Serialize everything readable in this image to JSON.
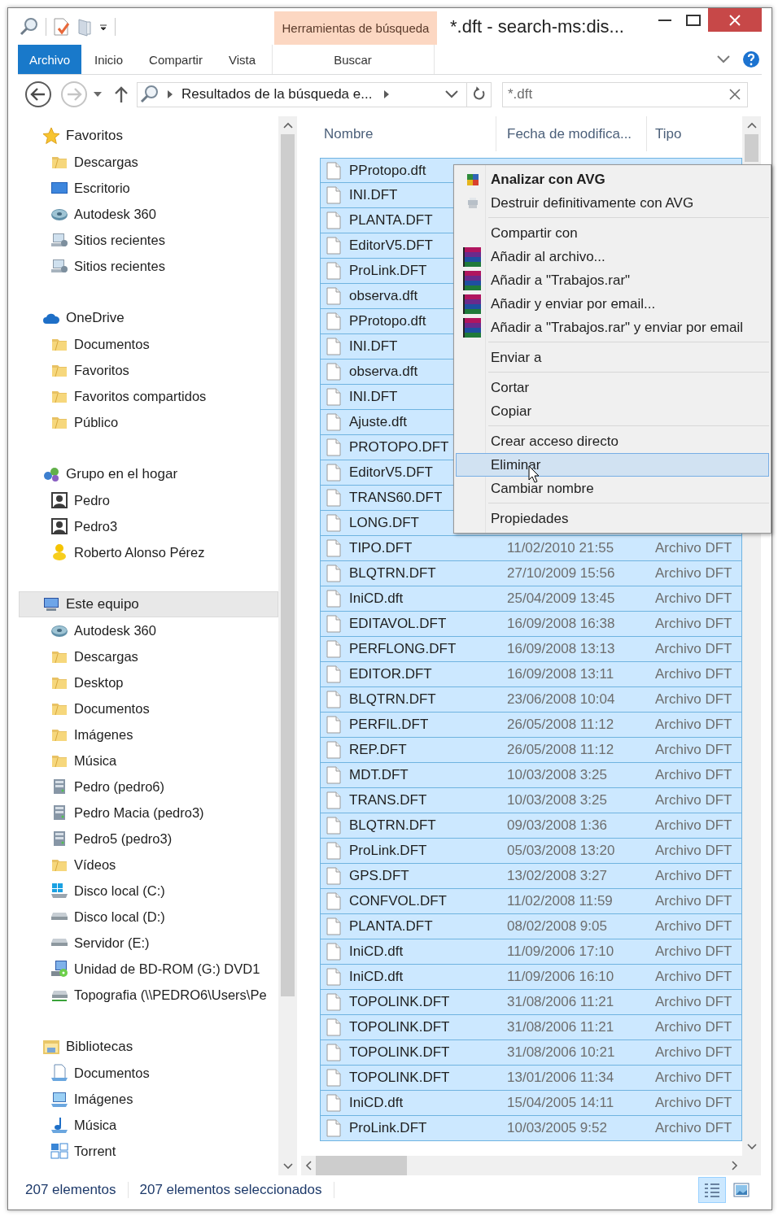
{
  "window": {
    "title": "*.dft - search-ms:dis..."
  },
  "context_tab": {
    "label": "Herramientas de búsqueda"
  },
  "ribbon_tabs": [
    {
      "label": "Archivo",
      "kind": "file",
      "selected": false
    },
    {
      "label": "Inicio",
      "kind": "tab",
      "selected": false
    },
    {
      "label": "Compartir",
      "kind": "tab",
      "selected": false
    },
    {
      "label": "Vista",
      "kind": "tab",
      "selected": false
    },
    {
      "label": "Buscar",
      "kind": "contextual",
      "selected": false
    }
  ],
  "navigation": {
    "back_disabled": false,
    "forward_disabled": true
  },
  "address_bar": {
    "path": "Resultados de la búsqueda e..."
  },
  "search": {
    "value": "*.dft"
  },
  "sidebar": {
    "groups": [
      {
        "label": "Favoritos",
        "kind": "star",
        "selected": false,
        "children": [
          {
            "label": "Descargas",
            "kind": "folder"
          },
          {
            "label": "Escritorio",
            "kind": "desktop"
          },
          {
            "label": "Autodesk 360",
            "kind": "disc"
          },
          {
            "label": "Sitios recientes",
            "kind": "recent"
          },
          {
            "label": "Sitios recientes",
            "kind": "recent"
          }
        ]
      },
      {
        "label": "OneDrive",
        "kind": "cloud",
        "selected": false,
        "children": [
          {
            "label": "Documentos",
            "kind": "folder"
          },
          {
            "label": "Favoritos",
            "kind": "folder"
          },
          {
            "label": "Favoritos compartidos",
            "kind": "folder"
          },
          {
            "label": "Público",
            "kind": "folder"
          }
        ]
      },
      {
        "label": "Grupo en el hogar",
        "kind": "people",
        "selected": false,
        "children": [
          {
            "label": "Pedro",
            "kind": "person"
          },
          {
            "label": "Pedro3",
            "kind": "person"
          },
          {
            "label": "Roberto Alonso Pérez",
            "kind": "figure"
          }
        ]
      },
      {
        "label": "Este equipo",
        "kind": "computer",
        "selected": true,
        "children": [
          {
            "label": "Autodesk 360",
            "kind": "disc"
          },
          {
            "label": "Descargas",
            "kind": "folder"
          },
          {
            "label": "Desktop",
            "kind": "folder"
          },
          {
            "label": "Documentos",
            "kind": "folder"
          },
          {
            "label": "Imágenes",
            "kind": "folder"
          },
          {
            "label": "Música",
            "kind": "folder"
          },
          {
            "label": "Pedro (pedro6)",
            "kind": "server"
          },
          {
            "label": "Pedro Macia (pedro3)",
            "kind": "server"
          },
          {
            "label": "Pedro5 (pedro3)",
            "kind": "server"
          },
          {
            "label": "Vídeos",
            "kind": "folder"
          },
          {
            "label": "Disco local (C:)",
            "kind": "system-drive"
          },
          {
            "label": "Disco local (D:)",
            "kind": "drive"
          },
          {
            "label": "Servidor (E:)",
            "kind": "drive"
          },
          {
            "label": "Unidad de BD-ROM (G:) DVD1",
            "kind": "optical"
          },
          {
            "label": "Topografia (\\\\PEDRO6\\Users\\Pe",
            "kind": "network-drive"
          }
        ]
      },
      {
        "label": "Bibliotecas",
        "kind": "library",
        "selected": false,
        "children": [
          {
            "label": "Documentos",
            "kind": "doc-library"
          },
          {
            "label": "Imágenes",
            "kind": "picture-library"
          },
          {
            "label": "Música",
            "kind": "music-library"
          },
          {
            "label": "Torrent",
            "kind": "grid"
          }
        ]
      }
    ]
  },
  "file_list": {
    "columns": [
      "Nombre",
      "Fecha de modifica...",
      "Tipo"
    ],
    "rows": [
      {
        "name": "PProtopo.dft",
        "selected": true
      },
      {
        "name": "INI.DFT",
        "selected": true
      },
      {
        "name": "PLANTA.DFT",
        "selected": true
      },
      {
        "name": "EditorV5.DFT",
        "selected": true
      },
      {
        "name": "ProLink.DFT",
        "selected": true
      },
      {
        "name": "observa.dft",
        "selected": true
      },
      {
        "name": "PProtopo.dft",
        "selected": true
      },
      {
        "name": "INI.DFT",
        "selected": true
      },
      {
        "name": "observa.dft",
        "selected": true
      },
      {
        "name": "INI.DFT",
        "selected": true
      },
      {
        "name": "Ajuste.dft",
        "selected": true
      },
      {
        "name": "PROTOPO.DFT",
        "selected": true
      },
      {
        "name": "EditorV5.DFT",
        "selected": true
      },
      {
        "name": "TRANS60.DFT",
        "selected": true
      },
      {
        "name": "LONG.DFT",
        "selected": true
      },
      {
        "name": "TIPO.DFT",
        "date": "11/02/2010 21:55",
        "type": "Archivo DFT",
        "selected": true
      },
      {
        "name": "BLQTRN.DFT",
        "date": "27/10/2009 15:56",
        "type": "Archivo DFT",
        "selected": true
      },
      {
        "name": "IniCD.dft",
        "date": "25/04/2009 13:45",
        "type": "Archivo DFT",
        "selected": true
      },
      {
        "name": "EDITAVOL.DFT",
        "date": "16/09/2008 16:38",
        "type": "Archivo DFT",
        "selected": true
      },
      {
        "name": "PERFLONG.DFT",
        "date": "16/09/2008 13:13",
        "type": "Archivo DFT",
        "selected": true
      },
      {
        "name": "EDITOR.DFT",
        "date": "16/09/2008 13:11",
        "type": "Archivo DFT",
        "selected": true
      },
      {
        "name": "BLQTRN.DFT",
        "date": "23/06/2008 10:04",
        "type": "Archivo DFT",
        "selected": true
      },
      {
        "name": "PERFIL.DFT",
        "date": "26/05/2008 11:12",
        "type": "Archivo DFT",
        "selected": true
      },
      {
        "name": "REP.DFT",
        "date": "26/05/2008 11:12",
        "type": "Archivo DFT",
        "selected": true
      },
      {
        "name": "MDT.DFT",
        "date": "10/03/2008 3:25",
        "type": "Archivo DFT",
        "selected": true
      },
      {
        "name": "TRANS.DFT",
        "date": "10/03/2008 3:25",
        "type": "Archivo DFT",
        "selected": true
      },
      {
        "name": "BLQTRN.DFT",
        "date": "09/03/2008 1:36",
        "type": "Archivo DFT",
        "selected": true
      },
      {
        "name": "ProLink.DFT",
        "date": "05/03/2008 13:20",
        "type": "Archivo DFT",
        "selected": true
      },
      {
        "name": "GPS.DFT",
        "date": "13/02/2008 3:27",
        "type": "Archivo DFT",
        "selected": true
      },
      {
        "name": "CONFVOL.DFT",
        "date": "11/02/2008 11:59",
        "type": "Archivo DFT",
        "selected": true
      },
      {
        "name": "PLANTA.DFT",
        "date": "08/02/2008 9:05",
        "type": "Archivo DFT",
        "selected": true
      },
      {
        "name": "IniCD.dft",
        "date": "11/09/2006 17:10",
        "type": "Archivo DFT",
        "selected": true
      },
      {
        "name": "IniCD.dft",
        "date": "11/09/2006 16:10",
        "type": "Archivo DFT",
        "selected": true
      },
      {
        "name": "TOPOLINK.DFT",
        "date": "31/08/2006 11:21",
        "type": "Archivo DFT",
        "selected": true
      },
      {
        "name": "TOPOLINK.DFT",
        "date": "31/08/2006 11:21",
        "type": "Archivo DFT",
        "selected": true
      },
      {
        "name": "TOPOLINK.DFT",
        "date": "31/08/2006 10:21",
        "type": "Archivo DFT",
        "selected": true
      },
      {
        "name": "TOPOLINK.DFT",
        "date": "13/01/2006 11:34",
        "type": "Archivo DFT",
        "selected": true
      },
      {
        "name": "IniCD.dft",
        "date": "15/04/2005 14:11",
        "type": "Archivo DFT",
        "selected": true
      },
      {
        "name": "ProLink.DFT",
        "date": "10/03/2005 9:52",
        "type": "Archivo DFT",
        "selected": true
      }
    ]
  },
  "context_menu": {
    "groups": [
      [
        {
          "label": "Analizar con AVG",
          "kind": "avg",
          "default": true,
          "selected": false
        },
        {
          "label": "Destruir definitivamente con AVG",
          "kind": "shredder",
          "default": false,
          "selected": false
        }
      ],
      [
        {
          "label": "Compartir con",
          "kind": "plain",
          "default": false,
          "selected": false
        },
        {
          "label": "Añadir al archivo...",
          "kind": "archive",
          "default": false,
          "selected": false
        },
        {
          "label": "Añadir a \"Trabajos.rar\"",
          "kind": "archive",
          "default": false,
          "selected": false
        },
        {
          "label": "Añadir y enviar por email...",
          "kind": "archive",
          "default": false,
          "selected": false
        },
        {
          "label": "Añadir a \"Trabajos.rar\" y enviar por email",
          "kind": "archive",
          "default": false,
          "selected": false
        }
      ],
      [
        {
          "label": "Enviar a",
          "kind": "plain",
          "default": false,
          "selected": false
        }
      ],
      [
        {
          "label": "Cortar",
          "kind": "plain",
          "default": false,
          "selected": false
        },
        {
          "label": "Copiar",
          "kind": "plain",
          "default": false,
          "selected": false
        }
      ],
      [
        {
          "label": "Crear acceso directo",
          "kind": "plain",
          "default": false,
          "selected": false
        },
        {
          "label": "Eliminar",
          "kind": "plain",
          "default": false,
          "selected": true
        },
        {
          "label": "Cambiar nombre",
          "kind": "plain",
          "default": false,
          "selected": false
        }
      ],
      [
        {
          "label": "Propiedades",
          "kind": "plain",
          "default": false,
          "selected": false
        }
      ]
    ]
  },
  "status_bar": {
    "item_count": "207 elementos",
    "selection": "207 elementos seleccionados",
    "views": [
      {
        "kind": "details",
        "selected": true
      },
      {
        "kind": "large-icons",
        "selected": false
      }
    ]
  }
}
